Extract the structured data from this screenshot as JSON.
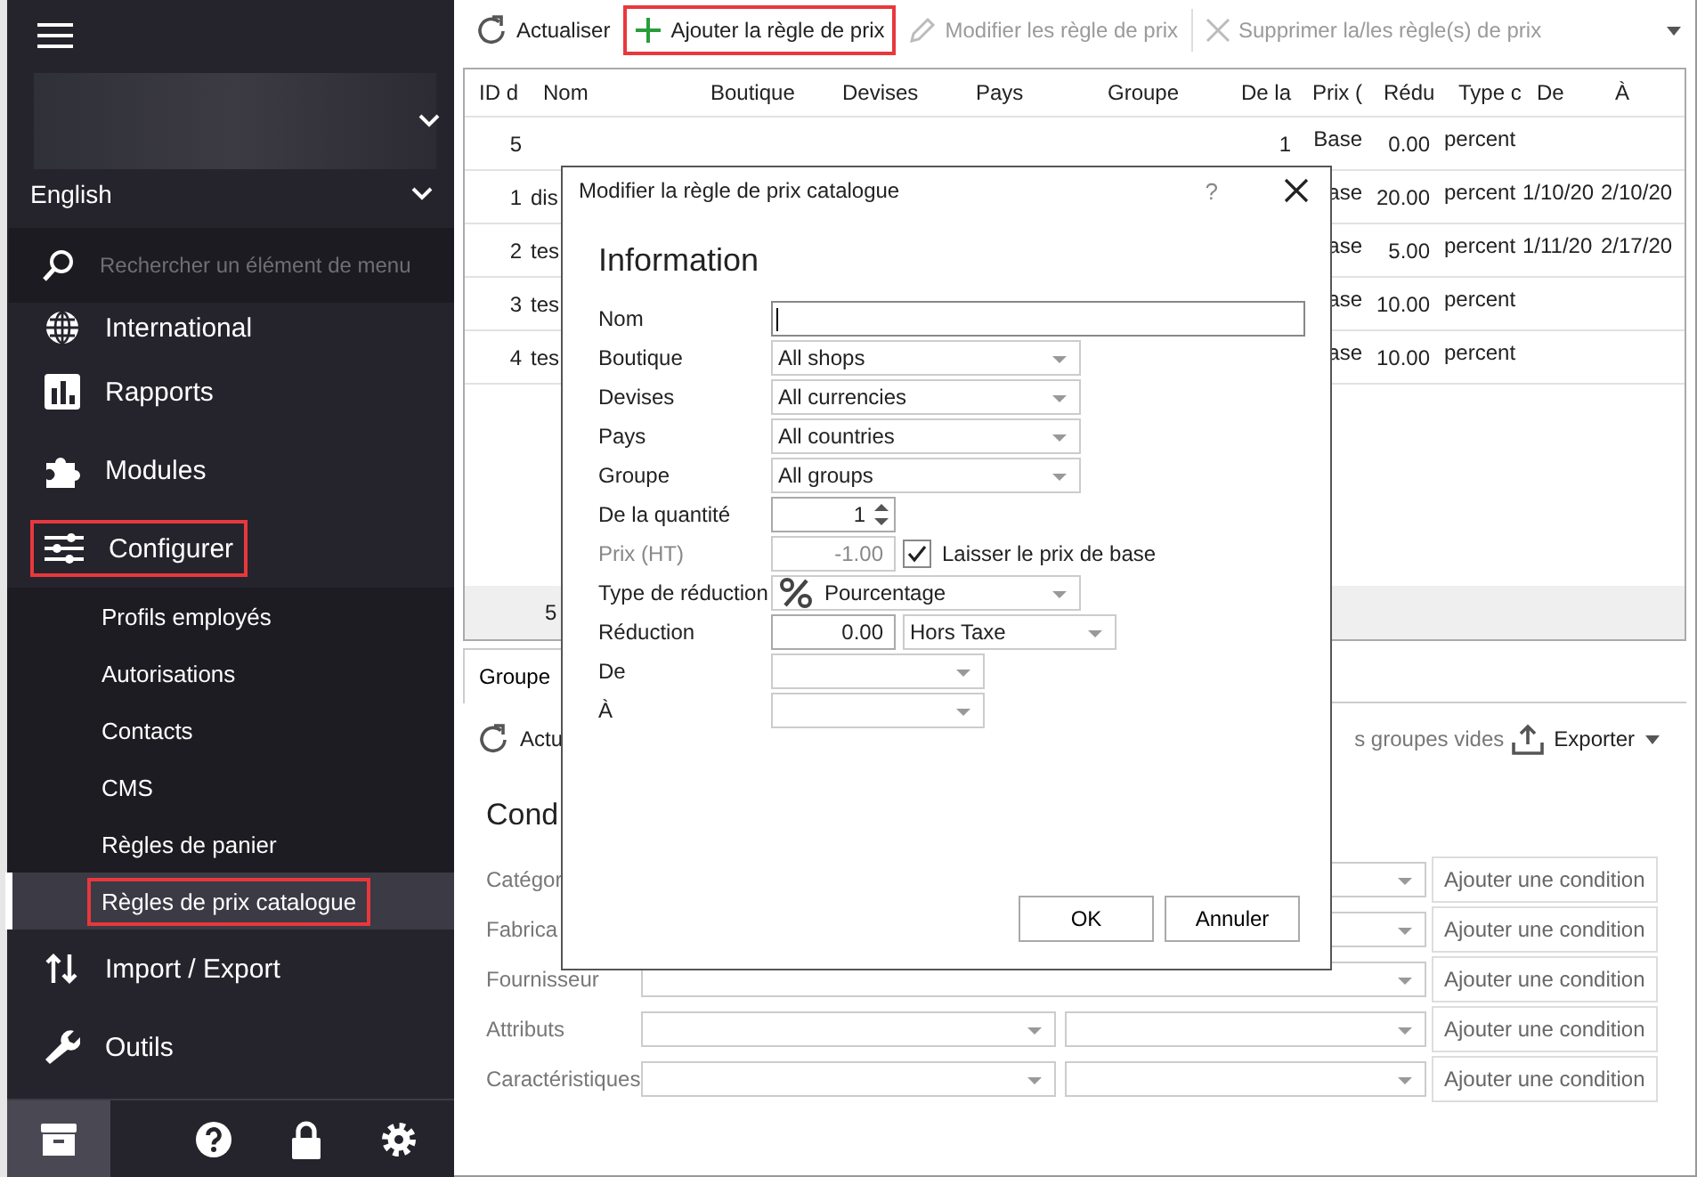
{
  "sidebar": {
    "language": "English",
    "search": {
      "placeholder": "Rechercher un élément de menu"
    },
    "items": [
      {
        "label": "International",
        "highlighted": false
      },
      {
        "label": "Rapports",
        "highlighted": false
      },
      {
        "label": "Modules",
        "highlighted": false
      },
      {
        "label": "Configurer",
        "highlighted": true,
        "children": [
          {
            "label": "Profils employés",
            "selected": false,
            "highlighted": false
          },
          {
            "label": "Autorisations",
            "selected": false,
            "highlighted": false
          },
          {
            "label": "Contacts",
            "selected": false,
            "highlighted": false
          },
          {
            "label": "CMS",
            "selected": false,
            "highlighted": false
          },
          {
            "label": "Règles de panier",
            "selected": false,
            "highlighted": false
          },
          {
            "label": "Règles de prix catalogue",
            "selected": true,
            "highlighted": true
          }
        ]
      },
      {
        "label": "Import / Export",
        "highlighted": false
      },
      {
        "label": "Outils",
        "highlighted": false
      }
    ],
    "footer_buttons": [
      {
        "selected": true
      },
      {
        "selected": false
      },
      {
        "selected": false
      },
      {
        "selected": false
      }
    ]
  },
  "toolbar": {
    "buttons": [
      {
        "label": "Actualiser",
        "disabled": false,
        "highlighted": false
      },
      {
        "label": "Ajouter la règle de prix",
        "disabled": false,
        "highlighted": true
      },
      {
        "label": "Modifier les règle de prix",
        "disabled": true,
        "highlighted": false
      },
      {
        "label": "Supprimer la/les règle(s) de prix",
        "disabled": true,
        "highlighted": false
      }
    ]
  },
  "table": {
    "columns": [
      "ID d",
      "Nom",
      "Boutique",
      "Devises",
      "Pays",
      "Groupe",
      "De la",
      "Prix (",
      "Rédu",
      "Type c",
      "De",
      "À"
    ],
    "rows": [
      [
        "5",
        null,
        null,
        null,
        null,
        null,
        "1",
        "Base",
        "0.00",
        "percent",
        null,
        null
      ],
      [
        "1",
        "dis",
        null,
        null,
        null,
        null,
        null,
        "ase",
        "20.00",
        "percent",
        "1/10/20",
        "2/10/20"
      ],
      [
        "2",
        "tes",
        null,
        null,
        null,
        null,
        null,
        "ase",
        "5.00",
        "percent",
        "1/11/20",
        "2/17/20"
      ],
      [
        "3",
        "tes",
        null,
        null,
        null,
        null,
        null,
        "ase",
        "10.00",
        "percent",
        null,
        null
      ],
      [
        "4",
        "tes",
        null,
        null,
        null,
        null,
        null,
        "ase",
        "10.00",
        "percent",
        null,
        null
      ]
    ],
    "footer": "5"
  },
  "details": {
    "tabs": [
      {
        "label": "Groupe",
        "selected": true
      }
    ],
    "toolbar": {
      "refresh": "Actu",
      "empty_groups": "s groupes vides",
      "export": "Exporter"
    },
    "conditions": {
      "title": "Cond",
      "rows": [
        {
          "label": "Catégor",
          "kind": "single",
          "button": "Ajouter une condition"
        },
        {
          "label": "Fabrica",
          "kind": "single",
          "button": "Ajouter une condition"
        },
        {
          "label": "Fournisseur",
          "kind": "single",
          "button": "Ajouter une condition"
        },
        {
          "label": "Attributs",
          "kind": "double",
          "button": "Ajouter une condition"
        },
        {
          "label": "Caractéristiques",
          "kind": "double",
          "button": "Ajouter une condition"
        }
      ]
    }
  },
  "dialog": {
    "title": "Modifier la règle de prix catalogue",
    "help": "?",
    "heading": "Information",
    "fields": [
      {
        "kind": "text",
        "label": "Nom",
        "focused": true,
        "disabled": false
      },
      {
        "kind": "select",
        "label": "Boutique",
        "value": "All shops",
        "disabled": false
      },
      {
        "kind": "select",
        "label": "Devises",
        "value": "All currencies",
        "disabled": false
      },
      {
        "kind": "select",
        "label": "Pays",
        "value": "All countries",
        "disabled": false
      },
      {
        "kind": "select",
        "label": "Groupe",
        "value": "All groups",
        "disabled": false
      },
      {
        "kind": "spinner",
        "label": "De la quantité",
        "value": "1",
        "disabled": false
      },
      {
        "kind": "price",
        "label": "Prix (HT)",
        "value": "-1.00",
        "disabled": true,
        "checkbox": {
          "label": "Laisser le prix de base",
          "checked": true
        }
      },
      {
        "kind": "reduction-type",
        "label": "Type de réduction",
        "value": "Pourcentage",
        "disabled": false
      },
      {
        "kind": "amount",
        "label": "Réduction",
        "value": "0.00",
        "unit": "Hors Taxe",
        "disabled": false
      },
      {
        "kind": "date",
        "label": "De",
        "disabled": false
      },
      {
        "kind": "date",
        "label": "À",
        "disabled": false
      }
    ],
    "buttons": [
      "OK",
      "Annuler"
    ]
  }
}
